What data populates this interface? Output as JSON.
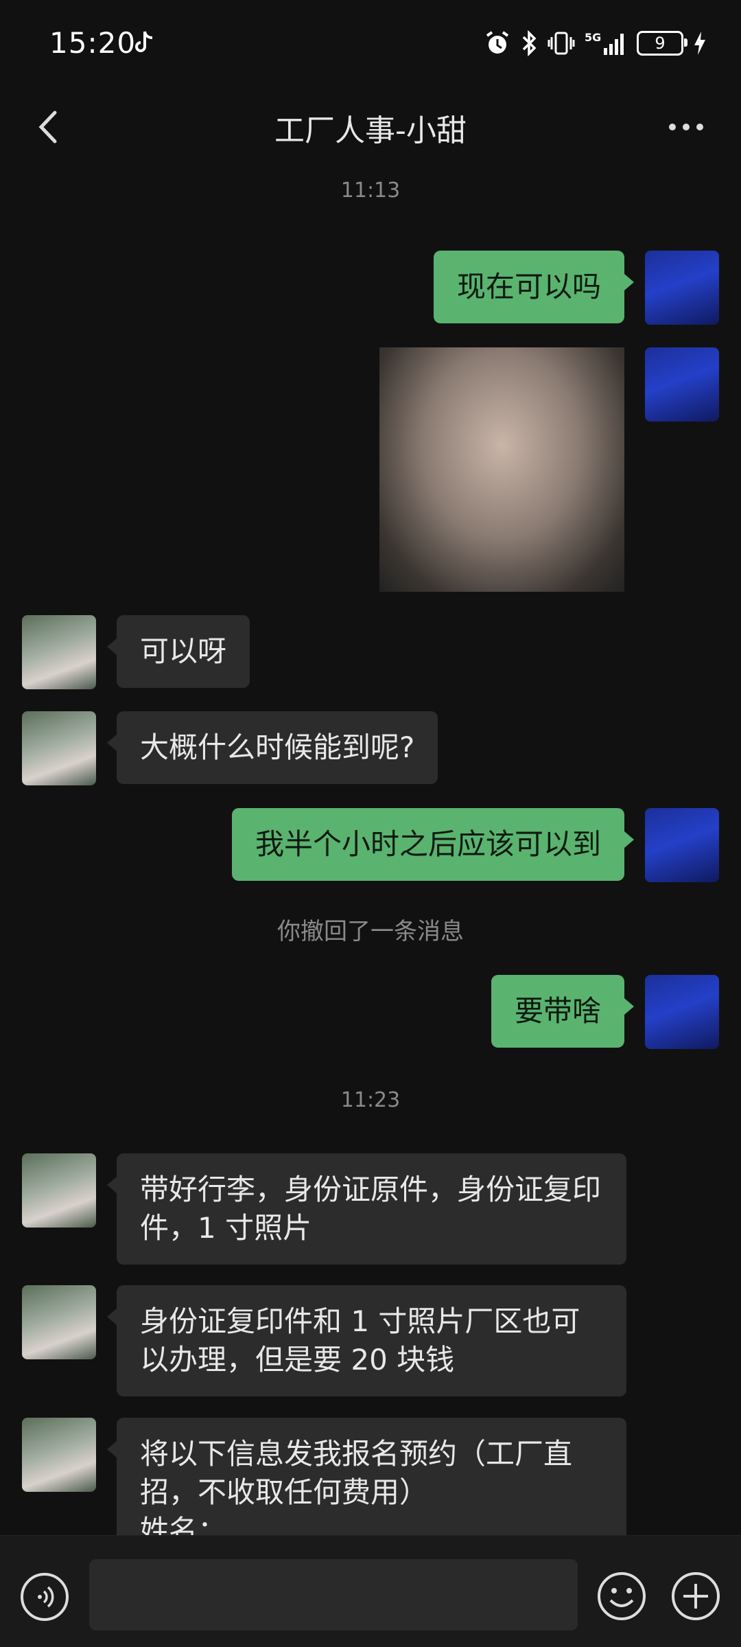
{
  "status_bar": {
    "time": "15:20",
    "battery": "9",
    "icons": [
      "tiktok-icon",
      "alarm-icon",
      "bluetooth-icon",
      "vibrate-icon",
      "5g-signal-icon",
      "battery-icon",
      "charging-icon"
    ]
  },
  "header": {
    "title": "工厂人事-小甜",
    "icons": [
      "back-chevron-icon",
      "more-dots-icon"
    ]
  },
  "messages": {
    "ts1": "11:13",
    "m1": "现在可以吗",
    "m3": "可以呀",
    "m4": "大概什么时候能到呢?",
    "m5": "我半个小时之后应该可以到",
    "sys1": "你撤回了一条消息",
    "m6": "要带啥",
    "ts2": "11:23",
    "m7": "带好行李，身份证原件，身份证复印件，1 寸照片",
    "m8": "身份证复印件和 1 寸照片厂区也可以办理，但是要 20 块钱",
    "m9": "将以下信息发我报名预约（工厂直招，不收取任何费用）",
    "m9b": "姓名："
  },
  "input_bar": {
    "icons": [
      "voice-icon",
      "emoji-icon",
      "plus-icon"
    ]
  },
  "colors": {
    "background": "#111111",
    "sent_bubble": "#5ab36f",
    "received_bubble": "#2c2c2c",
    "timestamp_text": "#8a8a8a"
  }
}
